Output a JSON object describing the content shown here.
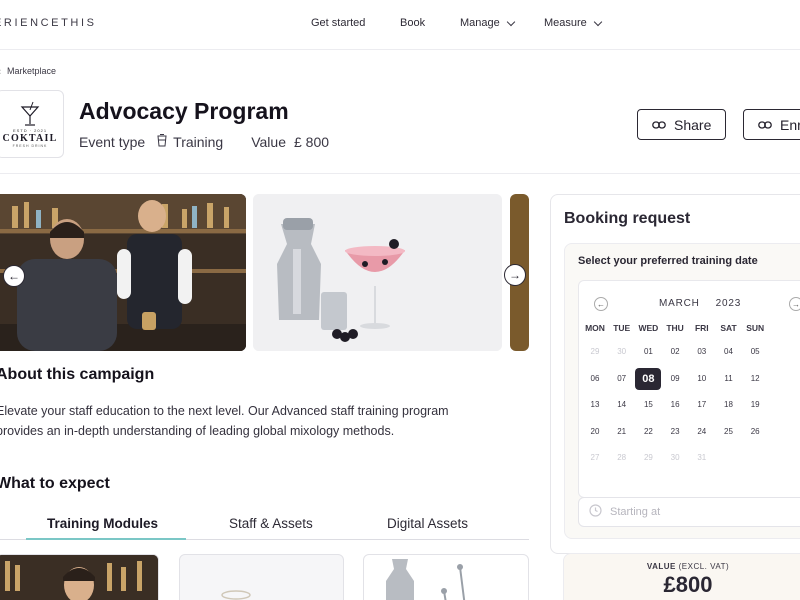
{
  "topnav": {
    "logo": "ERIENCETHIS",
    "items": [
      {
        "label": "Get started"
      },
      {
        "label": "Book"
      },
      {
        "label": "Manage"
      },
      {
        "label": "Measure"
      }
    ]
  },
  "breadcrumb": {
    "label": "Marketplace"
  },
  "brand": {
    "mini": "ESTD · 2021",
    "name": "COKTAIL",
    "tagline": "FRESH DRINK"
  },
  "header": {
    "title": "Advocacy Program",
    "event_type_label": "Event type",
    "event_type_value": "Training",
    "value_label": "Value",
    "value_amount": "£ 800",
    "share_label": "Share",
    "second_button_label": "Enr"
  },
  "about": {
    "title": "About this campaign",
    "text": "Elevate your staff education to the next level. Our Advanced staff training program provides an in-depth understanding of leading global mixology methods."
  },
  "expect": {
    "title": "What to expect",
    "tabs": [
      {
        "label": "Training Modules"
      },
      {
        "label": "Staff & Assets"
      },
      {
        "label": "Digital Assets"
      }
    ]
  },
  "booking": {
    "title": "Booking request",
    "select_label": "Select your preferred training date",
    "month": "MARCH",
    "year": "2023",
    "weekdays": [
      "MON",
      "TUE",
      "WED",
      "THU",
      "FRI",
      "SAT",
      "SUN"
    ],
    "weeks": [
      [
        "29",
        "30",
        "01",
        "02",
        "03",
        "04",
        "05"
      ],
      [
        "06",
        "07",
        "08",
        "09",
        "10",
        "11",
        "12"
      ],
      [
        "13",
        "14",
        "15",
        "16",
        "17",
        "18",
        "19"
      ],
      [
        "20",
        "21",
        "22",
        "23",
        "24",
        "25",
        "26"
      ],
      [
        "27",
        "28",
        "29",
        "30",
        "31",
        "",
        ""
      ]
    ],
    "selected_day": "08",
    "start_placeholder": "Starting at",
    "value_label": "VALUE",
    "value_note": "(EXCL. VAT)",
    "value_amount": "£800"
  },
  "colors": {
    "accent": "#7bc7c6",
    "dark": "#2a2733",
    "text": "#1d1a26"
  }
}
